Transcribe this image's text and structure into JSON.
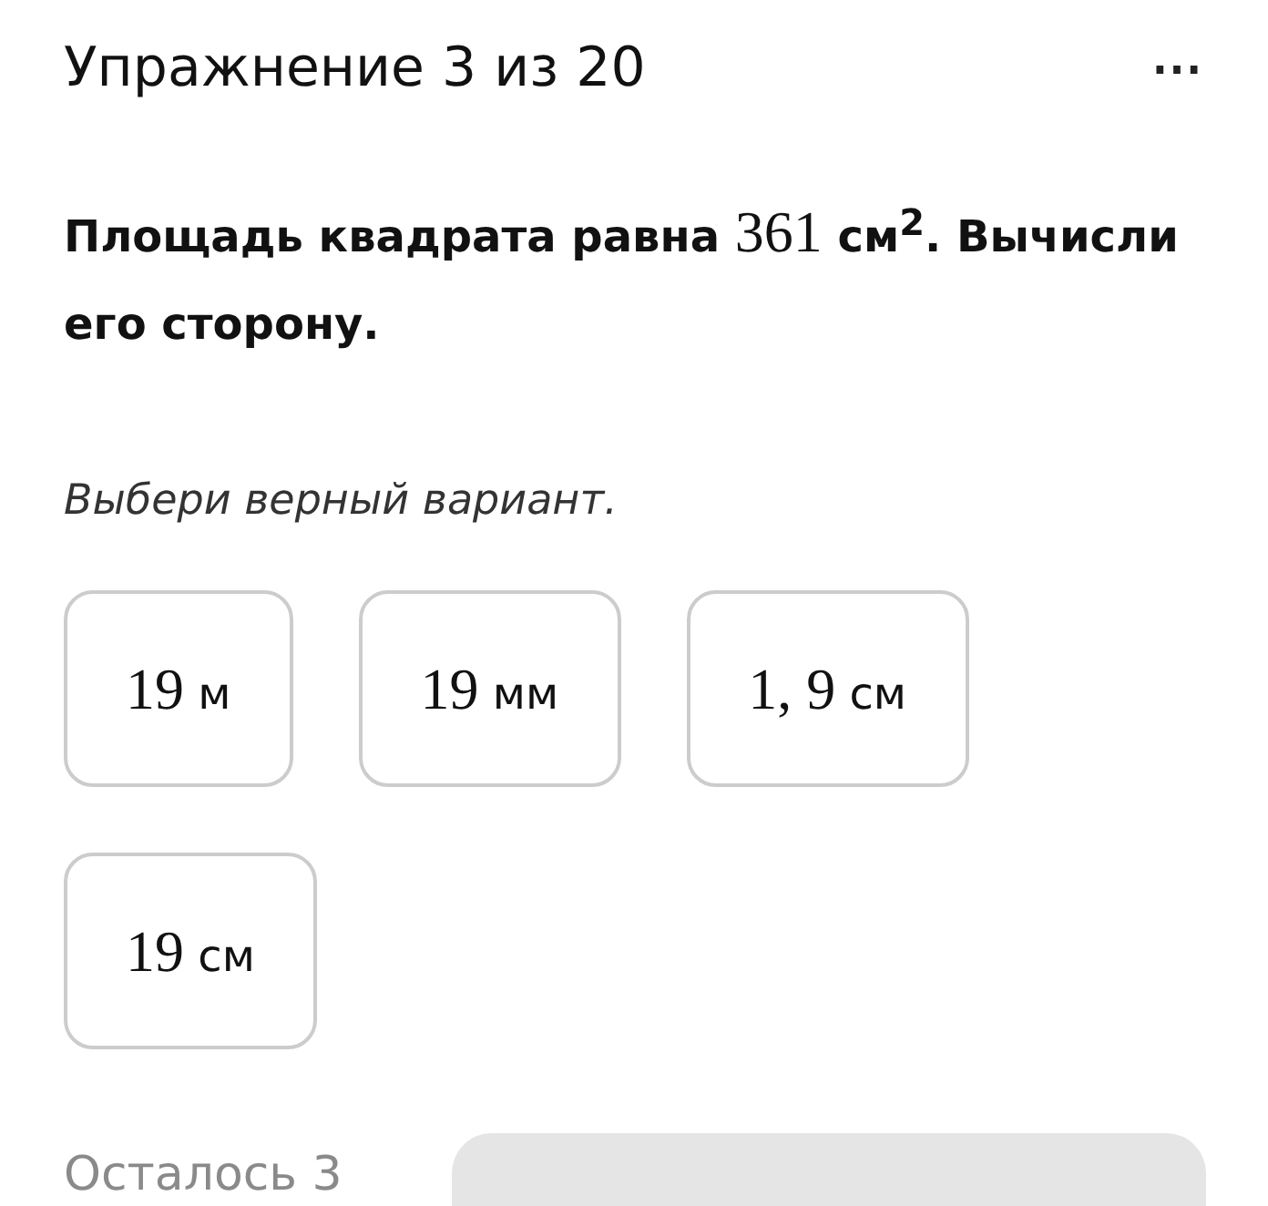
{
  "header": {
    "title": "Упражнение 3 из 20",
    "menu": "⋯"
  },
  "question": [
    {
      "kind": "text",
      "text": "Площадь квадрата равна "
    },
    {
      "kind": "math",
      "text": "361"
    },
    {
      "kind": "text",
      "text": " см$^{2}$. Вычисли его сторону."
    }
  ],
  "instruction": "Выбери верный вариант.",
  "options": [
    {
      "value": "19",
      "unit": "м"
    },
    {
      "value": "19",
      "unit": "мм"
    },
    {
      "value": "1, 9",
      "unit": "см"
    },
    {
      "value": "19",
      "unit": "см"
    }
  ],
  "footer": {
    "remaining": "Осталось 3"
  }
}
